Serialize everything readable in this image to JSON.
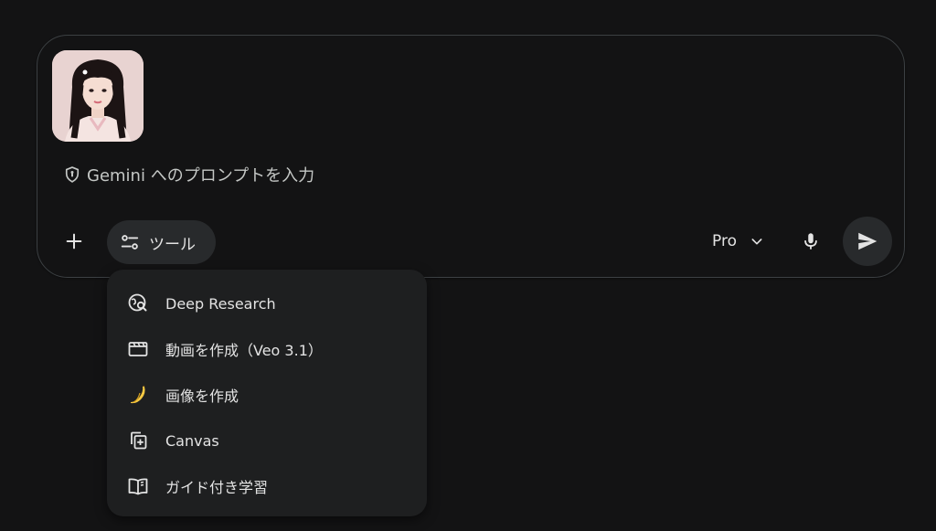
{
  "composer": {
    "attachment_alt": "attached image thumbnail",
    "placeholder": "Gemini へのプロンプトを入力",
    "tools_label": "ツール",
    "model_label": "Pro"
  },
  "tools_menu": {
    "items": [
      {
        "label": "Deep Research",
        "icon": "deep-research-icon"
      },
      {
        "label": "動画を作成（Veo 3.1）",
        "icon": "video-clapper-icon"
      },
      {
        "label": "画像を作成",
        "icon": "banana-icon"
      },
      {
        "label": "Canvas",
        "icon": "canvas-icon"
      },
      {
        "label": "ガイド付き学習",
        "icon": "open-book-icon"
      }
    ]
  },
  "colors": {
    "background": "#131314",
    "surface": "#1e1f20",
    "chip": "#282a2c",
    "border": "#3c4043",
    "text": "#e3e3e3",
    "muted_text": "#c4c7c5"
  }
}
